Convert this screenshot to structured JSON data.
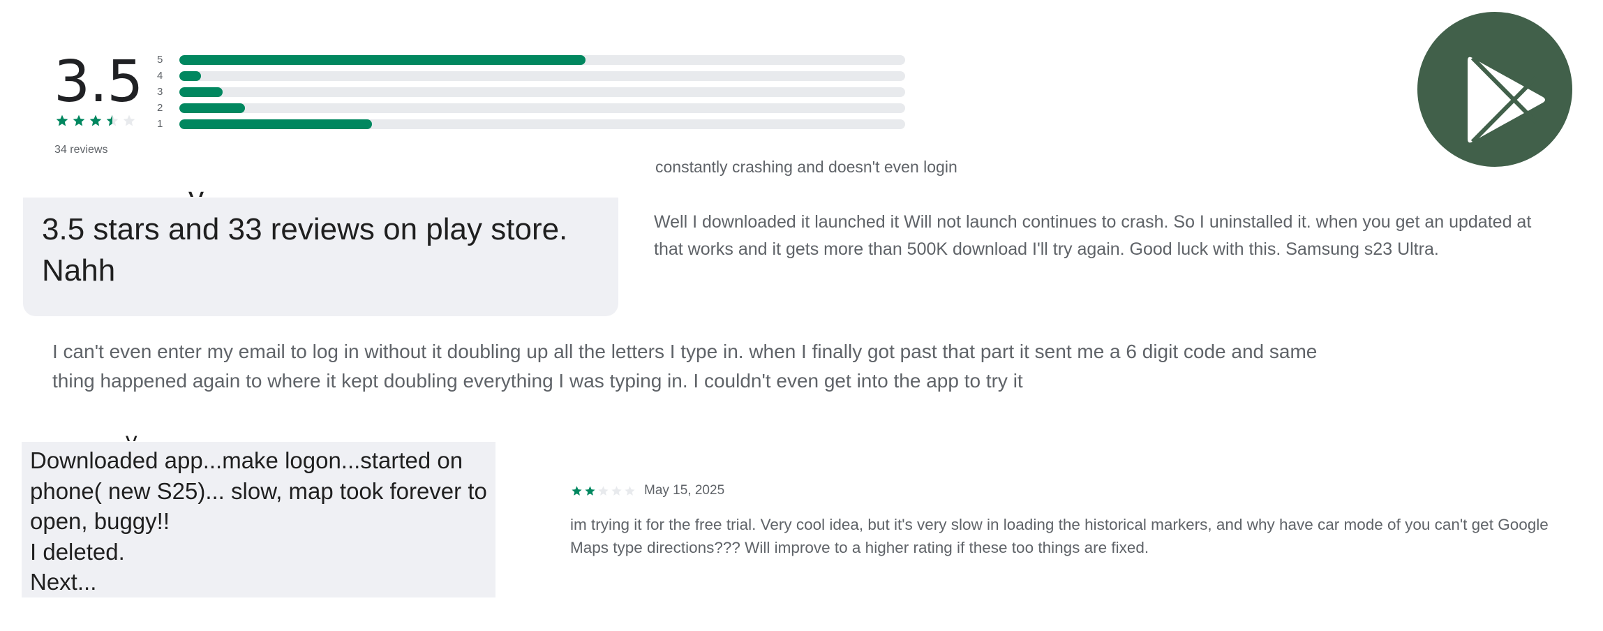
{
  "rating": {
    "score": "3.5",
    "stars_value": 3.5,
    "stars_max": 5,
    "review_count_label": "34 reviews",
    "accent_color": "#01875f",
    "histogram": [
      {
        "label": "5",
        "fraction": 0.56
      },
      {
        "label": "4",
        "fraction": 0.03
      },
      {
        "label": "3",
        "fraction": 0.06
      },
      {
        "label": "2",
        "fraction": 0.09
      },
      {
        "label": "1",
        "fraction": 0.265
      }
    ]
  },
  "logo": {
    "icon": "google-play-icon",
    "color": "#41604a"
  },
  "reviews": {
    "crash_short": "constantly crashing and doesn't even login",
    "bubble_line1": "3.5 stars and 33 reviews on play store.",
    "bubble_line2": "Nahh",
    "samsung": "Well I downloaded it launched it Will not launch continues to crash. So I uninstalled it. when you get an updated at that works and it gets more than 500K download I'll try again. Good luck with this. Samsung s23 Ultra.",
    "email": "I can't even enter my email to log in without it doubling up all the letters I type in. when I finally got past that part it sent me a 6 digit code and same thing happened again to where it kept doubling everything I was typing in. I couldn't even get into the app to try it",
    "downloaded_lines": [
      "Downloaded app...make logon...started on",
      "phone( new S25)... slow, map took forever to",
      "open, buggy!!",
      "I deleted.",
      "Next..."
    ],
    "trial": {
      "stars_value": 2,
      "date": "May 15, 2025",
      "text": "im trying it for the free trial. Very cool idea, but it's very slow in loading the historical markers, and why have car mode of you can't get Google Maps type directions??? Will improve to a higher rating if these too things are fixed."
    }
  }
}
